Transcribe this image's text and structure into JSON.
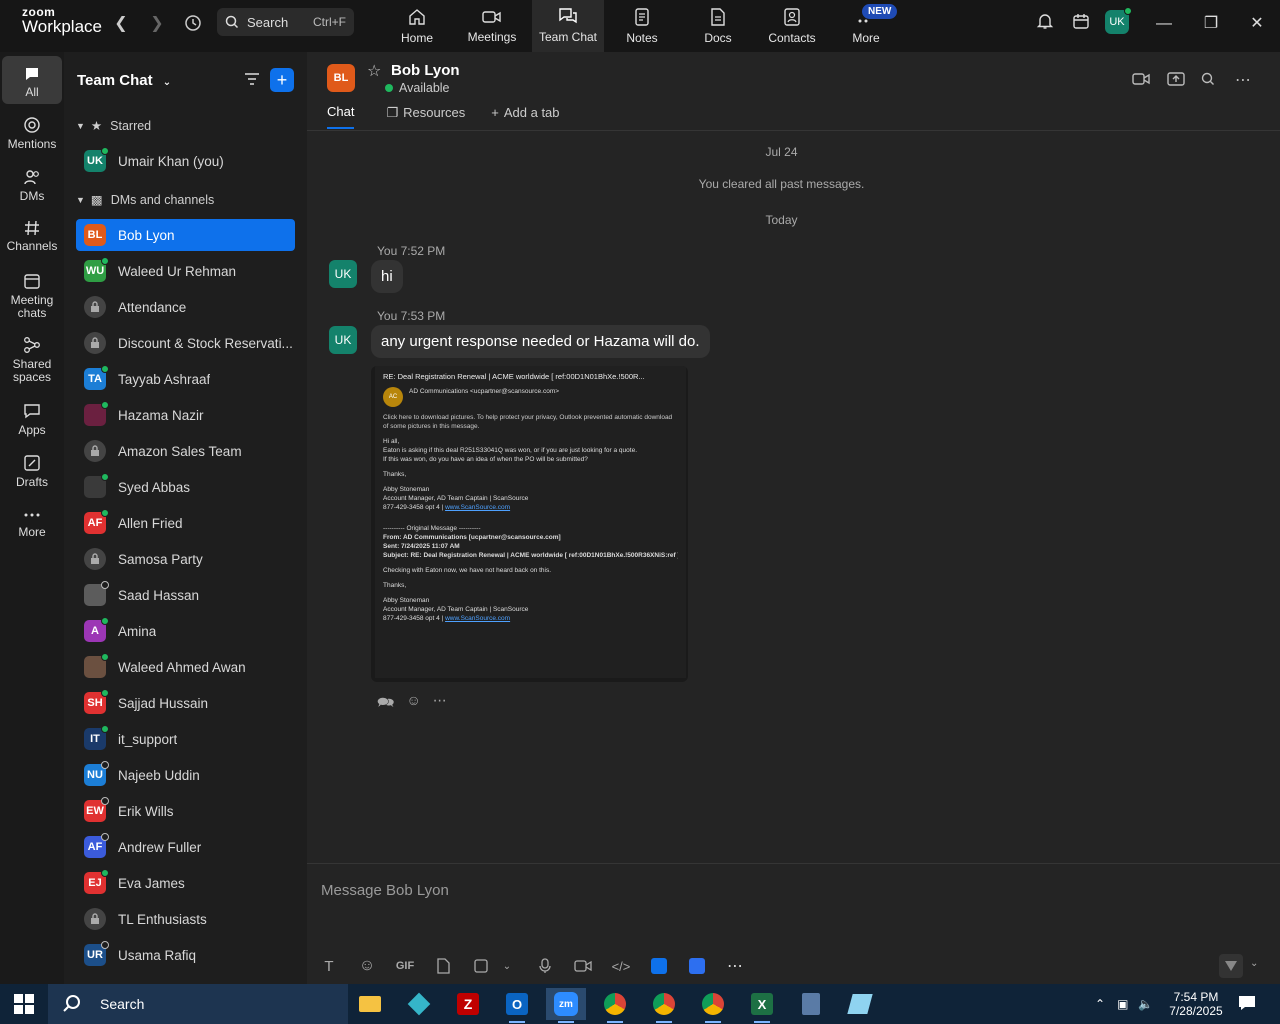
{
  "topbar": {
    "logo_line1": "zoom",
    "logo_line2": "Workplace",
    "search_label": "Search",
    "search_shortcut": "Ctrl+F",
    "nav": [
      {
        "label": "Home",
        "icon": "home-icon"
      },
      {
        "label": "Meetings",
        "icon": "meetings-icon"
      },
      {
        "label": "Team Chat",
        "icon": "team-chat-icon",
        "active": true
      },
      {
        "label": "Notes",
        "icon": "notes-icon"
      },
      {
        "label": "Docs",
        "icon": "docs-icon"
      },
      {
        "label": "Contacts",
        "icon": "contacts-icon"
      },
      {
        "label": "More",
        "icon": "more-icon"
      }
    ],
    "new_badge": "NEW",
    "profile_initials": "UK"
  },
  "rail": {
    "items": [
      {
        "label": "All",
        "icon": "chat-bubble-icon",
        "active": true
      },
      {
        "label": "Mentions",
        "icon": "at-icon"
      },
      {
        "label": "DMs",
        "icon": "people-icon"
      },
      {
        "label": "Channels",
        "icon": "hash-icon"
      },
      {
        "label": "Meeting chats",
        "icon": "calendar-icon"
      },
      {
        "label": "Shared spaces",
        "icon": "share-icon"
      },
      {
        "label": "Apps",
        "icon": "apps-icon"
      },
      {
        "label": "Drafts",
        "icon": "drafts-icon"
      },
      {
        "label": "More",
        "icon": "more-icon"
      }
    ]
  },
  "sidebar": {
    "title": "Team Chat",
    "starred_label": "Starred",
    "dms_label": "DMs and channels",
    "starred": [
      {
        "initials": "UK",
        "name": "Umair Khan (you)",
        "color": "#14826b",
        "status": "online"
      }
    ],
    "items": [
      {
        "initials": "BL",
        "name": "Bob Lyon",
        "color": "#e05a1a",
        "status": "none",
        "selected": true
      },
      {
        "initials": "WU",
        "name": "Waleed Ur Rehman",
        "color": "#2f9e44",
        "status": "online"
      },
      {
        "initials": "",
        "name": "Attendance",
        "color": "#444444",
        "status": "lock"
      },
      {
        "initials": "",
        "name": "Discount & Stock Reservati...",
        "color": "#444444",
        "status": "lock"
      },
      {
        "initials": "TA",
        "name": "Tayyab Ashraaf",
        "color": "#1c7ed6",
        "status": "online"
      },
      {
        "initials": "",
        "name": "Hazama Nazir",
        "color": "#6b2040",
        "status": "online"
      },
      {
        "initials": "",
        "name": "Amazon Sales Team",
        "color": "#444444",
        "status": "lock"
      },
      {
        "initials": "",
        "name": "Syed Abbas",
        "color": "#3a3a3a",
        "status": "online"
      },
      {
        "initials": "AF",
        "name": "Allen Fried",
        "color": "#e03131",
        "status": "online"
      },
      {
        "initials": "",
        "name": "Samosa Party",
        "color": "#444444",
        "status": "lock"
      },
      {
        "initials": "",
        "name": "Saad Hassan",
        "color": "#5c5c5c",
        "status": "offline"
      },
      {
        "initials": "A",
        "name": "Amina",
        "color": "#9c36b5",
        "status": "online"
      },
      {
        "initials": "",
        "name": "Waleed Ahmed Awan",
        "color": "#6b5040",
        "status": "online"
      },
      {
        "initials": "SH",
        "name": "Sajjad Hussain",
        "color": "#e03131",
        "status": "online"
      },
      {
        "initials": "IT",
        "name": "it_support",
        "color": "#1a3a6a",
        "status": "online"
      },
      {
        "initials": "NU",
        "name": "Najeeb Uddin",
        "color": "#1c7ed6",
        "status": "offline"
      },
      {
        "initials": "EW",
        "name": "Erik Wills",
        "color": "#e03131",
        "status": "offline"
      },
      {
        "initials": "AF",
        "name": "Andrew Fuller",
        "color": "#3b5bdb",
        "status": "offline"
      },
      {
        "initials": "EJ",
        "name": "Eva James",
        "color": "#e03131",
        "status": "online"
      },
      {
        "initials": "",
        "name": "TL Enthusiasts",
        "color": "#444444",
        "status": "lock"
      },
      {
        "initials": "UR",
        "name": "Usama Rafiq",
        "color": "#1c4f8a",
        "status": "offline"
      }
    ]
  },
  "chat": {
    "contact_initials": "BL",
    "contact_name": "Bob Lyon",
    "contact_status": "Available",
    "tabs": [
      "Chat",
      "Resources",
      "Add a tab"
    ],
    "date_old": "Jul 24",
    "cleared_text": "You cleared all past messages.",
    "date_today": "Today",
    "messages": [
      {
        "author": "You",
        "time": "7:52 PM",
        "initials": "UK",
        "text": "hi"
      },
      {
        "author": "You",
        "time": "7:53 PM",
        "initials": "UK",
        "text": "any urgent response needed or Hazama will do."
      }
    ],
    "attachment": {
      "subject": "RE: Deal Registration Renewal | ACME worldwide   [ ref:00D1N01BhXe.!500R...",
      "from": "AD Communications <ucpartner@scansource.com>",
      "hint": "Click here to download pictures. To help protect your privacy, Outlook prevented automatic download of some pictures in this message.",
      "greeting": "Hi all,",
      "line1": "Eaton is asking if this deal R251S33041Q was won, or if you are just looking for a quote.",
      "line2": "If this was won, do you have an idea of when the PO will be submitted?",
      "thanks": "Thanks,",
      "sig_name": "Abby Stoneman",
      "sig_title": "Account Manager, AD Team Captain | ScanSource",
      "sig_phone": "877-429-3458 opt 4 |",
      "sig_link": "www.ScanSource.com",
      "orig_header": "---------- Original Message ----------",
      "orig_from": "From: AD Communications [ucpartner@scansource.com]",
      "orig_sent": "Sent: 7/24/2025 11:07 AM",
      "orig_subject": "Subject: RE: Deal Registration Renewal | ACME worldwide [ ref:00D1N01BhXe.!500R36XNiS:ref ]",
      "orig_body": "Checking with Eaton now, we have not heard back on this."
    },
    "composer_placeholder": "Message Bob Lyon"
  },
  "taskbar": {
    "search_label": "Search",
    "time": "7:54 PM",
    "date": "7/28/2025"
  }
}
